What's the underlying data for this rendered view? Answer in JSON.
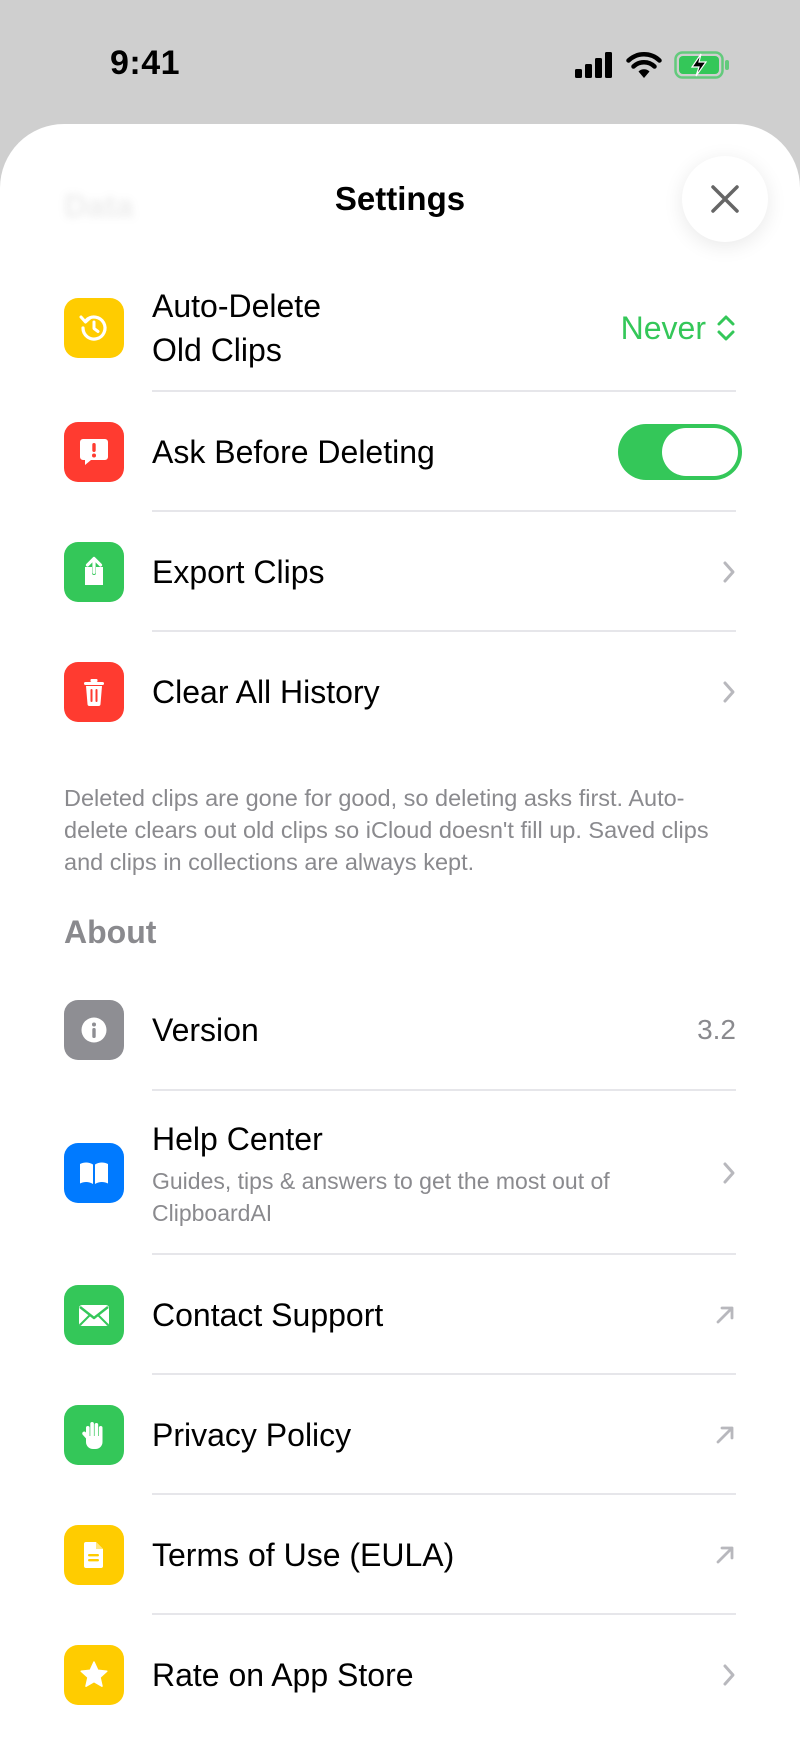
{
  "status_bar": {
    "time": "9:41"
  },
  "header": {
    "ghost_title": "Data",
    "title": "Settings"
  },
  "data_section": {
    "items": [
      {
        "label_line1": "Auto-Delete",
        "label_line2": "Old Clips",
        "value": "Never",
        "icon": "clock-history-icon",
        "icon_color": "#ffcc00"
      },
      {
        "label": "Ask Before Deleting",
        "toggle_on": true,
        "icon": "exclamation-bubble-icon",
        "icon_color": "#ff3b30"
      },
      {
        "label": "Export Clips",
        "icon": "share-upload-icon",
        "icon_color": "#34c759"
      },
      {
        "label": "Clear All History",
        "icon": "trash-icon",
        "icon_color": "#ff3b30"
      }
    ],
    "footnote": "Deleted clips are gone for good, so deleting asks first. Auto-delete clears out old clips so iCloud doesn't fill up. Saved clips and clips in collections are always kept."
  },
  "about_section": {
    "header": "About",
    "items": [
      {
        "label": "Version",
        "value": "3.2",
        "icon": "info-icon",
        "icon_color": "#8e8e93"
      },
      {
        "label": "Help Center",
        "sublabel": "Guides, tips & answers to get the most out of ClipboardAI",
        "icon": "book-icon",
        "icon_color": "#007aff"
      },
      {
        "label": "Contact Support",
        "icon": "envelope-icon",
        "icon_color": "#34c759"
      },
      {
        "label": "Privacy Policy",
        "icon": "hand-raised-icon",
        "icon_color": "#34c759"
      },
      {
        "label": "Terms of Use (EULA)",
        "icon": "document-icon",
        "icon_color": "#ffcc00"
      },
      {
        "label": "Rate on App Store",
        "icon": "star-icon",
        "icon_color": "#ffcc00"
      }
    ]
  },
  "colors": {
    "accent": "#34c759",
    "secondary_text": "#8a8a8e",
    "separator": "#e6e6ea"
  }
}
